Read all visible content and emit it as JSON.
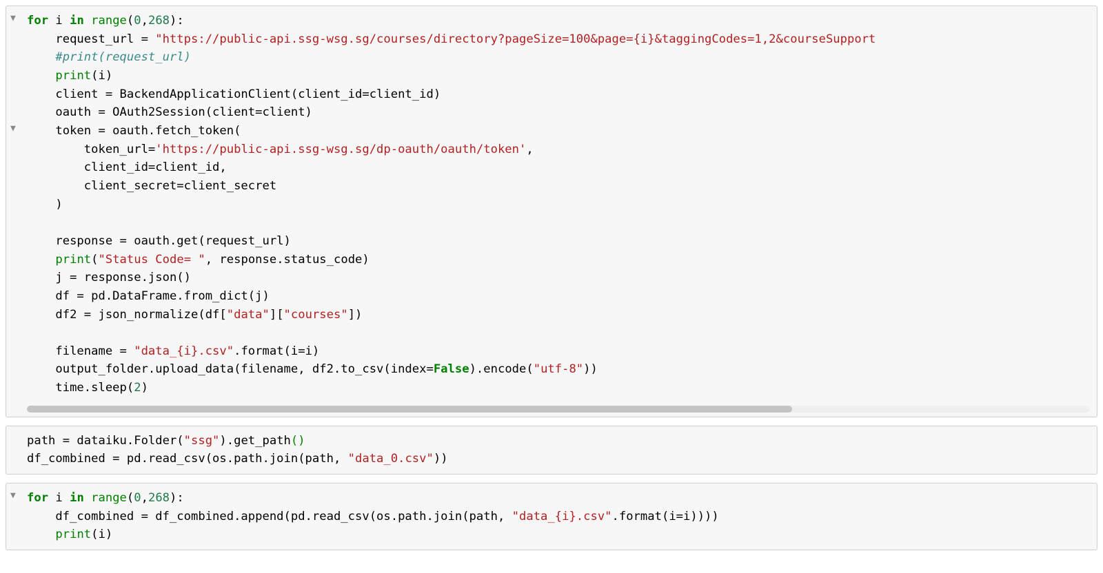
{
  "cells": [
    {
      "folds": [
        {
          "topPx": 8,
          "glyph": "▼"
        },
        {
          "topPx": 168,
          "glyph": "▼"
        }
      ],
      "scroll_thumb_pct": 72,
      "code_html": "<span class=\"kw\">for</span> i <span class=\"kw\">in</span> <span class=\"bltn\">range</span>(<span class=\"num\">0</span>,<span class=\"num\">268</span>):\n    request_url = <span class=\"str\">\"https://public-api.ssg-wsg.sg/courses/directory?pageSize=100&amp;page={i}&amp;taggingCodes=1,2&amp;courseSupport</span>\n    <span class=\"comm\">#print(request_url)</span>\n    <span class=\"bltn\">print</span>(i)\n    client = BackendApplicationClient(client_id=client_id)\n    oauth = OAuth2Session(client=client)\n    token = oauth.fetch_token(\n        token_url=<span class=\"str\">'https://public-api.ssg-wsg.sg/dp-oauth/oauth/token'</span>,\n        client_id=client_id,\n        client_secret=client_secret\n    )\n\n    response = oauth.get(request_url)\n    <span class=\"bltn\">print</span>(<span class=\"str\">\"Status Code= \"</span>, response.status_code)\n    j = response.json()\n    df = pd.DataFrame.from_dict(j)\n    df2 = json_normalize(df[<span class=\"str\">\"data\"</span>][<span class=\"str\">\"courses\"</span>])\n\n    filename = <span class=\"str\">\"data_{i}.csv\"</span>.format(i=i)\n    output_folder.upload_data(filename, df2.to_csv(index=<span class=\"kwc\">False</span>).encode(<span class=\"str\">\"utf-8\"</span>))\n    time.sleep(<span class=\"num\">2</span>)"
    },
    {
      "folds": [],
      "code_html": "path = dataiku.Folder(<span class=\"str\">\"ssg\"</span>).get_path<span class=\"bltn\">()</span>\ndf_combined = pd.read_csv(os.path.join(path, <span class=\"str\">\"data_0.csv\"</span>))"
    },
    {
      "folds": [
        {
          "topPx": 8,
          "glyph": "▼"
        }
      ],
      "code_html": "<span class=\"kw\">for</span> i <span class=\"kw\">in</span> <span class=\"bltn\">range</span>(<span class=\"num\">0</span>,<span class=\"num\">268</span>):\n    df_combined = df_combined.append(pd.read_csv(os.path.join(path, <span class=\"str\">\"data_{i}.csv\"</span>.format(i=i))))\n    <span class=\"bltn\">print</span>(i)"
    }
  ]
}
